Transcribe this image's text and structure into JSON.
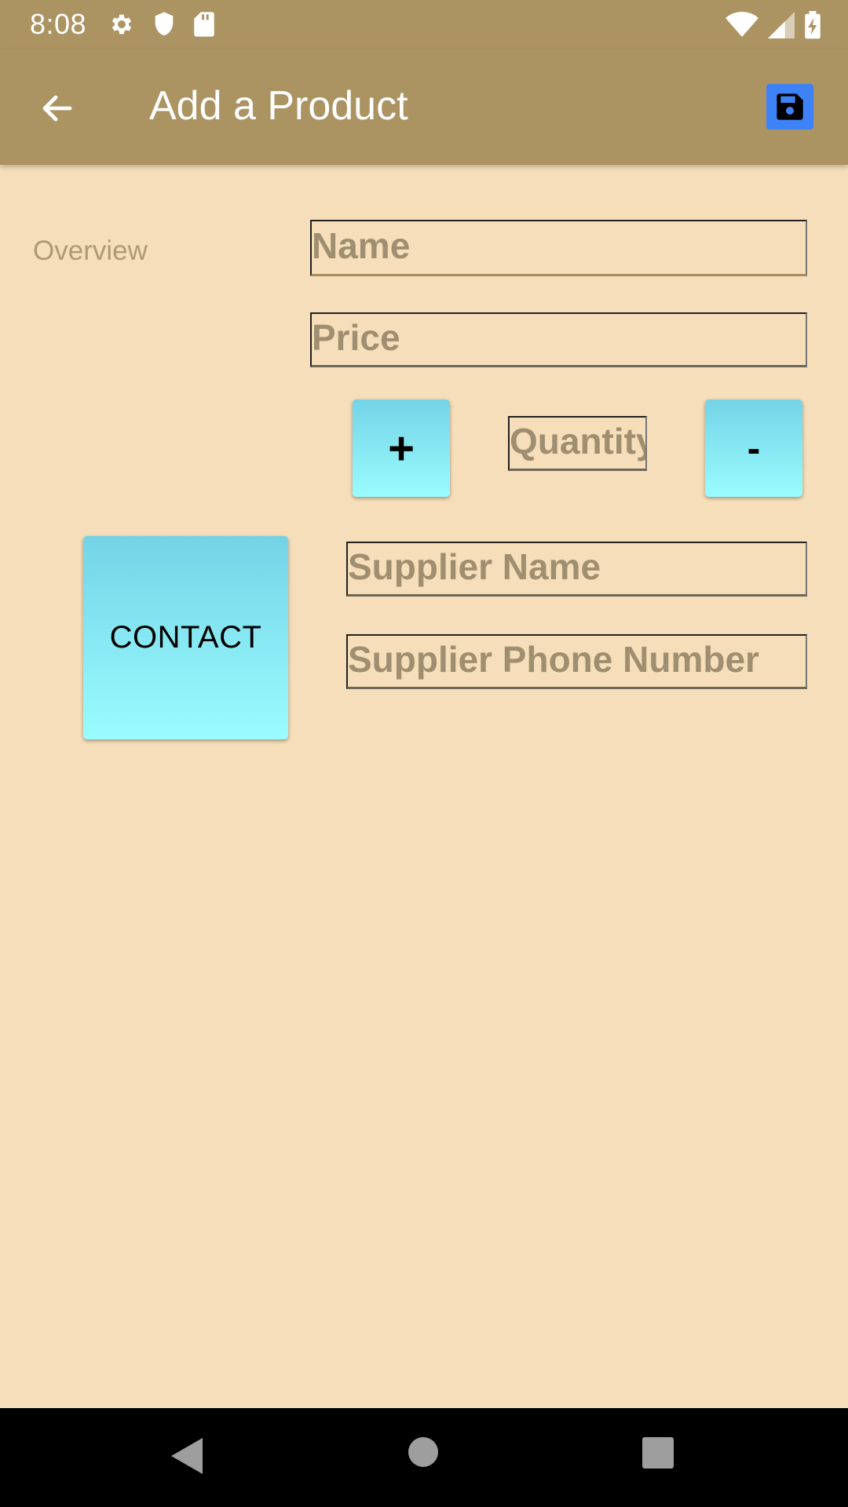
{
  "status_bar": {
    "time": "8:08",
    "icons_left": [
      "gear-icon",
      "shield-icon",
      "sd-card-icon"
    ],
    "icons_right": [
      "wifi-icon",
      "signal-icon",
      "battery-charging-icon"
    ]
  },
  "app_bar": {
    "back_icon": "arrow-left-icon",
    "title": "Add a Product",
    "save_icon": "floppy-disk-icon",
    "save_bg": "#3E82F7",
    "bg": "#AC9362"
  },
  "form": {
    "overview_label": "Overview",
    "name_placeholder": "Name",
    "price_placeholder": "Price",
    "quantity_placeholder": "Quantity",
    "plus_label": "+",
    "minus_label": "-",
    "contact_label": "CONTACT",
    "supplier_name_placeholder": "Supplier Name",
    "supplier_phone_placeholder": "Supplier Phone Number"
  },
  "colors": {
    "page_bg": "#F5DEB9",
    "button_gradient_top": "#74D3E6",
    "button_gradient_bottom": "#9AFCFF"
  },
  "nav_bar": {
    "icons": [
      "nav-back-icon",
      "nav-home-icon",
      "nav-recents-icon"
    ]
  }
}
